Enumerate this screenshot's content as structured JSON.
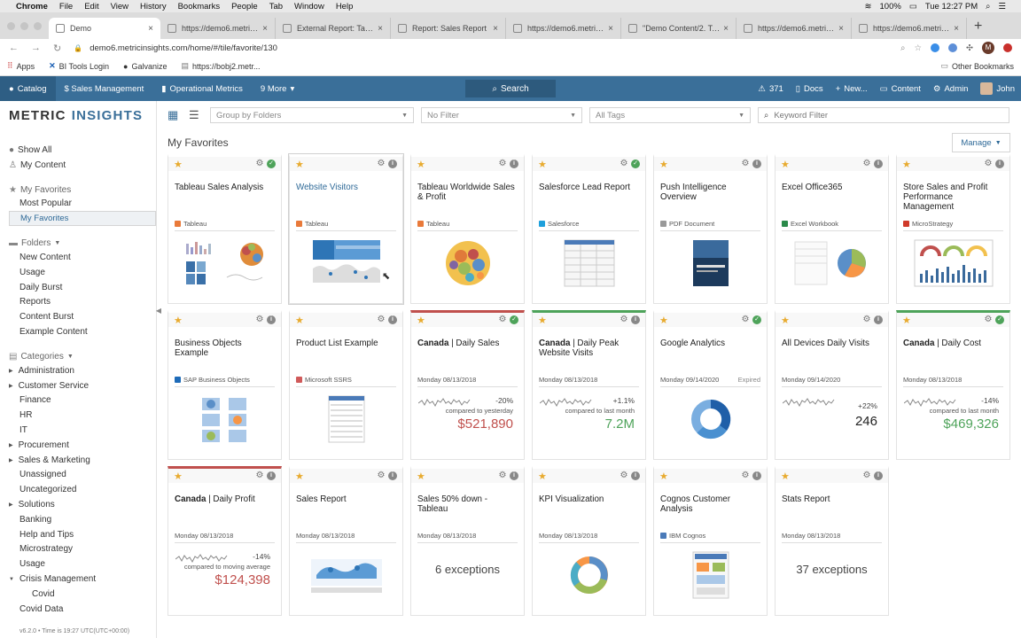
{
  "macbar": {
    "app": "Chrome",
    "menus": [
      "File",
      "Edit",
      "View",
      "History",
      "Bookmarks",
      "People",
      "Tab",
      "Window",
      "Help"
    ],
    "battery": "100%",
    "clock": "Tue 12:27 PM"
  },
  "tabs": [
    {
      "title": "Demo",
      "active": true
    },
    {
      "title": "https://demo6.metricins..."
    },
    {
      "title": "External Report: Tableau..."
    },
    {
      "title": "Report: Sales Report"
    },
    {
      "title": "https://demo6.metricins..."
    },
    {
      "title": "\"Demo Content/2. Tabl..."
    },
    {
      "title": "https://demo6.metricins..."
    },
    {
      "title": "https://demo6.metricins..."
    }
  ],
  "address": {
    "url": "demo6.metricinsights.com/home/#/tile/favorite/130",
    "profile": "M"
  },
  "bookmarks": {
    "items": [
      "Apps",
      "BI Tools Login",
      "Galvanize",
      "https://bobj2.metr..."
    ],
    "other": "Other Bookmarks"
  },
  "appnav": {
    "catalog": "Catalog",
    "sales": "$ Sales Management",
    "ops": "Operational Metrics",
    "more": "9 More",
    "search": "Search",
    "alerts": "371",
    "docs": "Docs",
    "new": "New...",
    "content": "Content",
    "admin": "Admin",
    "user": "John"
  },
  "sidebar": {
    "logo_left": "METRIC",
    "logo_right": "INSIGHTS",
    "show_all": "Show All",
    "my_content": "My Content",
    "favorites_header": "My Favorites",
    "most_popular": "Most Popular",
    "my_favorites": "My Favorites",
    "folders_header": "Folders",
    "folders": [
      "New Content",
      "Usage",
      "Daily Burst",
      "Reports",
      "Content Burst",
      "Example Content"
    ],
    "categories_header": "Categories",
    "categories": [
      {
        "label": "Administration",
        "tri": true
      },
      {
        "label": "Customer Service",
        "tri": true
      },
      {
        "label": "Finance",
        "tri": false
      },
      {
        "label": "HR",
        "tri": false
      },
      {
        "label": "IT",
        "tri": false
      },
      {
        "label": "Procurement",
        "tri": true
      },
      {
        "label": "Sales & Marketing",
        "tri": true
      },
      {
        "label": "Unassigned",
        "tri": false
      },
      {
        "label": "Uncategorized",
        "tri": false
      },
      {
        "label": "Solutions",
        "tri": true
      },
      {
        "label": "Banking",
        "tri": false
      },
      {
        "label": "Help and Tips",
        "tri": false
      },
      {
        "label": "Microstrategy",
        "tri": false
      },
      {
        "label": "Usage",
        "tri": false
      },
      {
        "label": "Crisis Management",
        "tri": true,
        "open": true
      },
      {
        "label": "Covid",
        "sub": true
      },
      {
        "label": "Covid Data",
        "tri": false
      }
    ],
    "footer": "v6.2.0 • Time is 19:27 UTC(UTC+00:00)"
  },
  "filters": {
    "group": "Group by Folders",
    "filter": "No Filter",
    "tags": "All Tags",
    "keyword_placeholder": "Keyword Filter"
  },
  "page_title": "My Favorites",
  "manage": "Manage",
  "tiles": [
    {
      "title": "Tableau Sales Analysis",
      "source": "Tableau",
      "src_color": "#e97a3a",
      "status": "ok",
      "thumb": "tableau1"
    },
    {
      "title": "Website Visitors",
      "source": "Tableau",
      "src_color": "#e97a3a",
      "status": "info",
      "thumb": "map",
      "link": true,
      "hover": true
    },
    {
      "title": "Tableau Worldwide Sales & Profit",
      "source": "Tableau",
      "src_color": "#e97a3a",
      "status": "info",
      "thumb": "bubbles"
    },
    {
      "title": "Salesforce Lead Report",
      "source": "Salesforce",
      "src_color": "#1ea0dc",
      "status": "ok",
      "thumb": "table"
    },
    {
      "title": "Push Intelligence Overview",
      "source": "PDF Document",
      "src_color": "#999",
      "status": "info",
      "thumb": "pdf"
    },
    {
      "title": "Excel Office365",
      "source": "Excel Workbook",
      "src_color": "#2a8a4a",
      "status": "info",
      "thumb": "excel"
    },
    {
      "title": "Store Sales and Profit Performance Management",
      "source": "MicroStrategy",
      "src_color": "#d03a2a",
      "status": "info",
      "thumb": "gauges"
    },
    {
      "title": "Business Objects Example",
      "source": "SAP Business Objects",
      "src_color": "#1e6bb8",
      "status": "info",
      "thumb": "bo"
    },
    {
      "title": "Product List Example",
      "source": "Microsoft SSRS",
      "src_color": "#d05a5a",
      "status": "info",
      "thumb": "ssrs"
    },
    {
      "title_bold": "Canada",
      "title": " | Daily Sales",
      "date": "Monday 08/13/2018",
      "pct": "-20%",
      "cmp": "compared to yesterday",
      "value": "$521,890",
      "vcolor": "red",
      "status": "ok",
      "border": "red",
      "type": "metric"
    },
    {
      "title_bold": "Canada",
      "title": " | Daily Peak Website Visits",
      "date": "Monday 08/13/2018",
      "pct": "+1.1%",
      "cmp": "compared to last month",
      "value": "7.2M",
      "vcolor": "green",
      "status": "info",
      "border": "green",
      "type": "metric"
    },
    {
      "title": "Google Analytics",
      "date": "Monday 09/14/2020",
      "expired": "Expired",
      "status": "ok",
      "thumb": "donut"
    },
    {
      "title": "All Devices Daily Visits",
      "date": "Monday 09/14/2020",
      "pct": "+22%",
      "cmp": "",
      "value": "246",
      "vcolor": "dark",
      "status": "info",
      "type": "metric"
    },
    {
      "title_bold": "Canada",
      "title": " | Daily Cost",
      "date": "Monday 08/13/2018",
      "pct": "-14%",
      "cmp": "compared to last month",
      "value": "$469,326",
      "vcolor": "green",
      "status": "ok",
      "border": "green",
      "type": "metric"
    },
    {
      "title_bold": "Canada",
      "title": " | Daily Profit",
      "date": "Monday 08/13/2018",
      "pct": "-14%",
      "cmp": "compared to moving average",
      "value": "$124,398",
      "vcolor": "red",
      "status": "info",
      "border": "red",
      "type": "metric"
    },
    {
      "title": "Sales Report",
      "date": "Monday 08/13/2018",
      "status": "info",
      "thumb": "salesmap"
    },
    {
      "title": "Sales 50% down - Tableau",
      "date": "Monday 08/13/2018",
      "status": "info",
      "type": "exc",
      "exc": "6 exceptions"
    },
    {
      "title": "KPI Visualization",
      "date": "Monday 08/13/2018",
      "status": "info",
      "thumb": "donut2"
    },
    {
      "title": "Cognos Customer Analysis",
      "source": "IBM Cognos",
      "src_color": "#4a7ab8",
      "status": "info",
      "thumb": "cognos"
    },
    {
      "title": "Stats Report",
      "date": "Monday 08/13/2018",
      "status": "info",
      "type": "exc",
      "exc": "37 exceptions"
    }
  ]
}
